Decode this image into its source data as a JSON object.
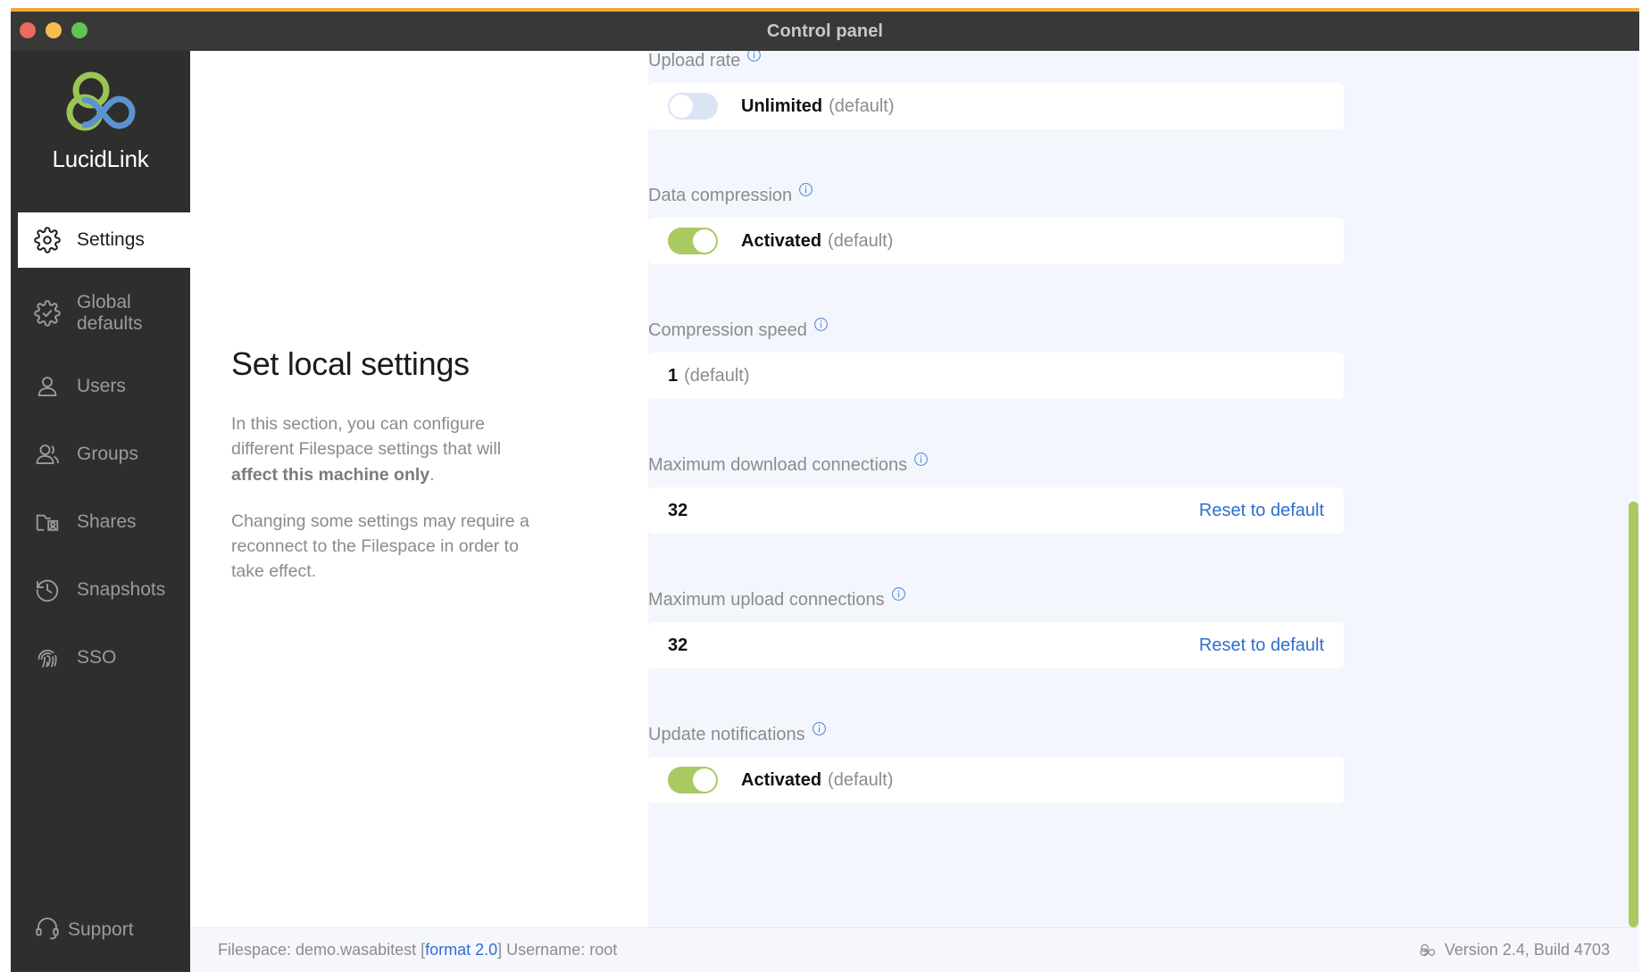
{
  "window": {
    "title": "Control panel",
    "accent_color": "#f0a83a",
    "traffic_lights": [
      "close",
      "minimize",
      "maximize"
    ]
  },
  "sidebar": {
    "brand": "LucidLink",
    "items": [
      {
        "label": "Settings",
        "icon": "gear-icon",
        "active": true
      },
      {
        "label": "Global defaults",
        "icon": "gear-check-icon",
        "active": false
      },
      {
        "label": "Users",
        "icon": "user-icon",
        "active": false
      },
      {
        "label": "Groups",
        "icon": "users-icon",
        "active": false
      },
      {
        "label": "Shares",
        "icon": "folder-user-icon",
        "active": false
      },
      {
        "label": "Snapshots",
        "icon": "clock-history-icon",
        "active": false
      },
      {
        "label": "SSO",
        "icon": "fingerprint-icon",
        "active": false
      }
    ],
    "support": {
      "label": "Support",
      "icon": "headset-icon"
    }
  },
  "info": {
    "title": "Set local settings",
    "paragraph1_pre": "In this section, you can configure different Filespace settings that will ",
    "paragraph1_bold": "affect this machine only",
    "paragraph1_post": ".",
    "paragraph2": "Changing some settings may require a reconnect to the Filespace in order to take effect."
  },
  "settings": {
    "upload_rate": {
      "label": "Upload rate",
      "toggle_state": "off",
      "value": "Unlimited",
      "default_note": "(default)"
    },
    "data_compression": {
      "label": "Data compression",
      "toggle_state": "on",
      "value": "Activated",
      "default_note": "(default)"
    },
    "compression_speed": {
      "label": "Compression speed",
      "value": "1",
      "default_note": "(default)"
    },
    "max_download_connections": {
      "label": "Maximum download connections",
      "value": "32",
      "reset_label": "Reset to default"
    },
    "max_upload_connections": {
      "label": "Maximum upload connections",
      "value": "32",
      "reset_label": "Reset to default"
    },
    "update_notifications": {
      "label": "Update notifications",
      "toggle_state": "on",
      "value": "Activated",
      "default_note": "(default)"
    }
  },
  "footer": {
    "filespace_prefix": "Filespace: demo.wasabitest [",
    "format_link": "format 2.0",
    "filespace_suffix": "] Username: root",
    "version": "Version 2.4, Build 4703"
  },
  "colors": {
    "accent_green": "#a9ca61",
    "link_blue": "#2f6fd0",
    "sidebar_bg": "#2e2e2c",
    "panel_bg": "#f3f6fd"
  }
}
